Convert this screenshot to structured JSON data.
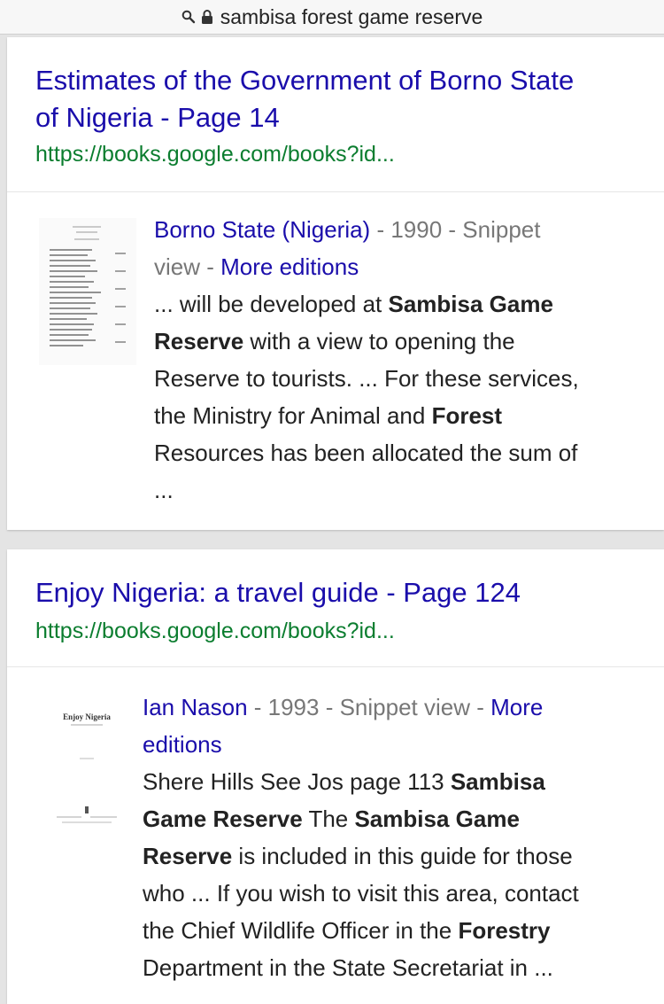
{
  "address_bar": {
    "query": "sambisa forest game reserve"
  },
  "results": [
    {
      "title_line1": "Estimates of the Government of Borno State",
      "title_line2": "of Nigeria - Page 14",
      "url": "https://books.google.com/books?id...",
      "author": "Borno State (Nigeria)",
      "year_sep": " - 1990 - Snippet",
      "view_sep": "view - ",
      "more_editions": "More editions",
      "snip1": "... will be developed at ",
      "snip1_b": "Sambisa Game",
      "snip2_b": "Reserve",
      "snip2": " with a view to opening the",
      "snip3": "Reserve to tourists. ... For these services,",
      "snip4": "the Ministry for Animal and ",
      "snip4_b": "Forest",
      "snip5": "Resources has been allocated the sum of",
      "snip6": " ..."
    },
    {
      "title": "Enjoy Nigeria: a travel guide - Page 124",
      "url": "https://books.google.com/books?id...",
      "author": "Ian Nason",
      "meta": " - 1993 - Snippet view - ",
      "more": "More",
      "editions": "editions",
      "thumb_title": "Enjoy Nigeria",
      "snip1": "Shere Hills See Jos page 113 ",
      "snip1_b": "Sambisa",
      "snip2_b": "Game Reserve",
      "snip2": " The ",
      "snip2_b2": "Sambisa Game",
      "snip3_b": "Reserve",
      "snip3": " is included in this guide for those",
      "snip4": "who ... If you wish to visit this area, contact",
      "snip5": "the Chief Wildlife Officer in the ",
      "snip5_b": "Forestry",
      "snip6": "Department in the State Secretariat in ..."
    }
  ]
}
